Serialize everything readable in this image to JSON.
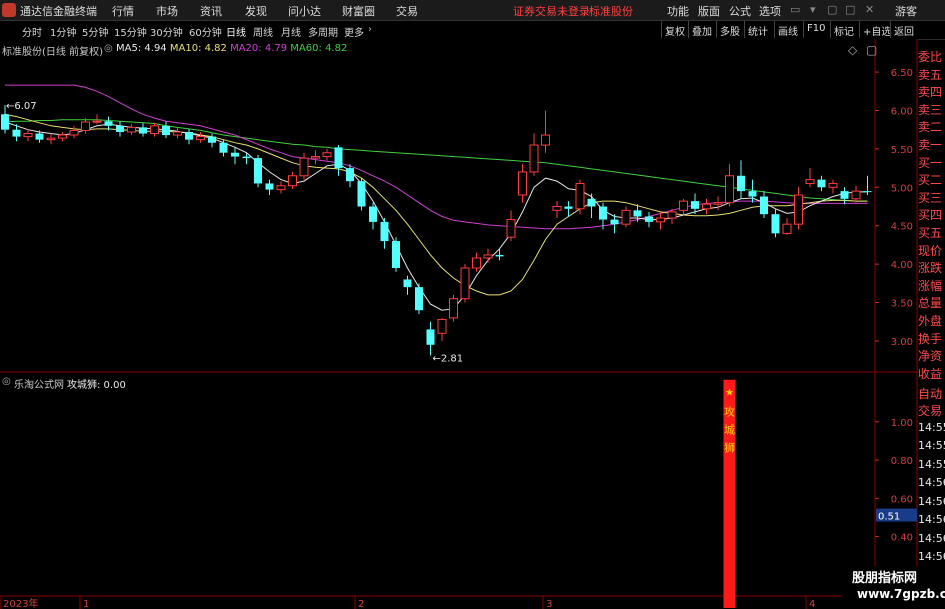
{
  "app": {
    "title": "通达信金融终端"
  },
  "menu": [
    "行情",
    "市场",
    "资讯",
    "发现",
    "问小达",
    "财富圈",
    "交易"
  ],
  "status": {
    "trade_notice": "证券交易未登录",
    "stock_name": "标准股份"
  },
  "right_menu": [
    "功能",
    "版面",
    "公式",
    "选项",
    "游客"
  ],
  "period_tabs": [
    "分时",
    "1分钟",
    "5分钟",
    "15分钟",
    "30分钟",
    "60分钟",
    "日线",
    "周线",
    "月线",
    "多周期",
    "更多"
  ],
  "active_tab": "日线",
  "right_buttons": [
    "复权",
    "叠加",
    "多股",
    "统计",
    "画线",
    "F10",
    "标记",
    "+自选",
    "返回"
  ],
  "main_chart": {
    "stock_label": "标准股份(日线 前复权)",
    "ma": [
      {
        "name": "MA5",
        "value": "4.94",
        "color": "#e8e8e8"
      },
      {
        "name": "MA10",
        "value": "4.82",
        "color": "#e8e070"
      },
      {
        "name": "MA20",
        "value": "4.79",
        "color": "#d040d0"
      },
      {
        "name": "MA60",
        "value": "4.82",
        "color": "#40d040"
      }
    ],
    "high_marker": "6.07",
    "low_marker": "2.81"
  },
  "sub_chart": {
    "label": "乐淘公式网",
    "indicator": "攻城狮: 0.00",
    "signal_text": [
      "攻",
      "城",
      "狮"
    ],
    "current_value": "0.51"
  },
  "side_panel": [
    "委比",
    "卖五",
    "卖四",
    "卖三",
    "卖二",
    "卖一",
    "买一",
    "买二",
    "买三",
    "买四",
    "买五",
    "现价",
    "涨跌",
    "涨幅",
    "总量",
    "外盘",
    "换手",
    "净资",
    "收益",
    "自动",
    "交易",
    "14:55",
    "14:55",
    "14:55",
    "14:56",
    "14:56",
    "14:56",
    "14:56",
    "14:56",
    "14:56"
  ],
  "x_axis": [
    "2023年",
    "1",
    "2",
    "3",
    "4"
  ],
  "watermark": {
    "line1": "股朋指标网",
    "line2": "www.7gpzb.com"
  },
  "chart_data": [
    {
      "type": "candlestick",
      "y_axis": {
        "min": 2.7,
        "max": 6.8,
        "ticks": [
          6.5,
          6.0,
          5.5,
          5.0,
          4.5,
          4.0,
          3.5,
          3.0
        ],
        "tick_labels": [
          "6.50",
          "6.00",
          "5.50",
          "5.00",
          "4.50",
          "4.00",
          "3.50",
          "3.00"
        ]
      },
      "candles": [
        [
          5.95,
          5.75,
          6.07,
          5.7
        ],
        [
          5.75,
          5.66,
          5.82,
          5.6
        ],
        [
          5.66,
          5.7,
          5.75,
          5.6
        ],
        [
          5.7,
          5.62,
          5.74,
          5.58
        ],
        [
          5.62,
          5.64,
          5.7,
          5.56
        ],
        [
          5.64,
          5.68,
          5.72,
          5.6
        ],
        [
          5.68,
          5.74,
          5.8,
          5.64
        ],
        [
          5.74,
          5.85,
          5.9,
          5.7
        ],
        [
          5.85,
          5.86,
          5.95,
          5.82
        ],
        [
          5.86,
          5.8,
          5.92,
          5.74
        ],
        [
          5.8,
          5.72,
          5.86,
          5.66
        ],
        [
          5.72,
          5.78,
          5.82,
          5.68
        ],
        [
          5.78,
          5.7,
          5.84,
          5.66
        ],
        [
          5.7,
          5.8,
          5.84,
          5.66
        ],
        [
          5.8,
          5.68,
          5.86,
          5.64
        ],
        [
          5.68,
          5.72,
          5.78,
          5.64
        ],
        [
          5.72,
          5.62,
          5.76,
          5.56
        ],
        [
          5.62,
          5.66,
          5.72,
          5.58
        ],
        [
          5.66,
          5.58,
          5.7,
          5.52
        ],
        [
          5.58,
          5.45,
          5.62,
          5.4
        ],
        [
          5.45,
          5.4,
          5.52,
          5.3
        ],
        [
          5.4,
          5.38,
          5.44,
          5.3
        ],
        [
          5.38,
          5.05,
          5.42,
          5.0
        ],
        [
          5.05,
          4.97,
          5.1,
          4.9
        ],
        [
          4.97,
          5.02,
          5.08,
          4.92
        ],
        [
          5.02,
          5.15,
          5.2,
          4.98
        ],
        [
          5.15,
          5.38,
          5.45,
          5.1
        ],
        [
          5.38,
          5.4,
          5.48,
          5.3
        ],
        [
          5.4,
          5.45,
          5.5,
          5.35
        ],
        [
          5.52,
          5.25,
          5.55,
          5.15
        ],
        [
          5.25,
          5.08,
          5.3,
          5.0
        ],
        [
          5.08,
          4.75,
          5.12,
          4.7
        ],
        [
          4.75,
          4.55,
          4.8,
          4.45
        ],
        [
          4.55,
          4.3,
          4.6,
          4.2
        ],
        [
          4.3,
          3.95,
          4.35,
          3.9
        ],
        [
          3.8,
          3.7,
          3.85,
          3.6
        ],
        [
          3.7,
          3.4,
          3.75,
          3.35
        ],
        [
          3.15,
          2.95,
          3.25,
          2.81
        ],
        [
          3.1,
          3.28,
          3.3,
          3.0
        ],
        [
          3.3,
          3.55,
          3.6,
          3.25
        ],
        [
          3.55,
          3.95,
          4.0,
          3.5
        ],
        [
          3.95,
          4.08,
          4.15,
          3.9
        ],
        [
          4.08,
          4.12,
          4.2,
          4.02
        ],
        [
          4.12,
          4.1,
          4.2,
          4.05
        ],
        [
          4.35,
          4.58,
          4.7,
          4.3
        ],
        [
          4.9,
          5.2,
          5.3,
          4.8
        ],
        [
          5.2,
          5.55,
          5.7,
          5.15
        ],
        [
          5.55,
          5.68,
          6.0,
          5.45
        ],
        [
          4.7,
          4.75,
          4.82,
          4.6
        ],
        [
          4.75,
          4.72,
          4.82,
          4.62
        ],
        [
          4.72,
          5.05,
          5.1,
          4.65
        ],
        [
          4.85,
          4.75,
          4.92,
          4.6
        ],
        [
          4.75,
          4.58,
          4.8,
          4.45
        ],
        [
          4.58,
          4.52,
          4.65,
          4.4
        ],
        [
          4.52,
          4.7,
          4.75,
          4.48
        ],
        [
          4.7,
          4.62,
          4.78,
          4.55
        ],
        [
          4.62,
          4.55,
          4.68,
          4.48
        ],
        [
          4.55,
          4.6,
          4.68,
          4.45
        ],
        [
          4.6,
          4.68,
          4.72,
          4.52
        ],
        [
          4.7,
          4.82,
          4.85,
          4.65
        ],
        [
          4.82,
          4.72,
          4.92,
          4.65
        ],
        [
          4.72,
          4.78,
          4.85,
          4.65
        ],
        [
          4.78,
          4.8,
          4.88,
          4.7
        ],
        [
          4.8,
          5.15,
          5.3,
          4.75
        ],
        [
          5.15,
          4.95,
          5.35,
          4.85
        ],
        [
          4.95,
          4.88,
          5.1,
          4.8
        ],
        [
          4.88,
          4.65,
          4.95,
          4.6
        ],
        [
          4.65,
          4.4,
          4.72,
          4.35
        ],
        [
          4.4,
          4.52,
          4.6,
          4.38
        ],
        [
          4.52,
          4.9,
          5.0,
          4.45
        ],
        [
          5.05,
          5.1,
          5.25,
          5.0
        ],
        [
          5.1,
          5.0,
          5.15,
          4.95
        ],
        [
          5.0,
          5.05,
          5.1,
          4.92
        ],
        [
          4.95,
          4.85,
          5.0,
          4.78
        ],
        [
          4.85,
          4.95,
          5.02,
          4.8
        ],
        [
          4.95,
          4.94,
          5.15,
          4.9
        ]
      ],
      "ma60": [
        5.85,
        5.86,
        5.86,
        5.87,
        5.87,
        5.88,
        5.88,
        5.88,
        5.88,
        5.87,
        5.86,
        5.85,
        5.84,
        5.83,
        5.8,
        5.78,
        5.76,
        5.74,
        5.71,
        5.68,
        5.66,
        5.64,
        5.62,
        5.6,
        5.58,
        5.56,
        5.55,
        5.53,
        5.52,
        5.5,
        5.49,
        5.48,
        5.47,
        5.46,
        5.45,
        5.44,
        5.43,
        5.42,
        5.41,
        5.4,
        5.39,
        5.38,
        5.37,
        5.36,
        5.35,
        5.34,
        5.33,
        5.32,
        5.3,
        5.28,
        5.26,
        5.24,
        5.22,
        5.2,
        5.18,
        5.16,
        5.14,
        5.12,
        5.1,
        5.08,
        5.06,
        5.04,
        5.02,
        5.0,
        4.98,
        4.96,
        4.94,
        4.92,
        4.9,
        4.88,
        4.86,
        4.85,
        4.84,
        4.83,
        4.82,
        4.82
      ],
      "ma20": [
        6.33,
        6.33,
        6.33,
        6.33,
        6.33,
        6.33,
        6.33,
        6.3,
        6.25,
        6.18,
        6.1,
        6.02,
        5.95,
        5.9,
        5.86,
        5.84,
        5.82,
        5.8,
        5.76,
        5.72,
        5.68,
        5.62,
        5.56,
        5.5,
        5.45,
        5.4,
        5.38,
        5.36,
        5.34,
        5.32,
        5.28,
        5.22,
        5.15,
        5.08,
        5.0,
        4.9,
        4.8,
        4.7,
        4.62,
        4.57,
        4.55,
        4.53,
        4.51,
        4.5,
        4.49,
        4.48,
        4.47,
        4.46,
        4.46,
        4.46,
        4.47,
        4.48,
        4.5,
        4.52,
        4.55,
        4.58,
        4.62,
        4.66,
        4.7,
        4.74,
        4.77,
        4.79,
        4.8,
        4.81,
        4.82,
        4.82,
        4.82,
        4.81,
        4.8,
        4.79,
        4.79,
        4.79,
        4.79,
        4.79,
        4.79,
        4.79
      ],
      "ma10": [
        5.95,
        5.92,
        5.88,
        5.84,
        5.8,
        5.78,
        5.76,
        5.75,
        5.76,
        5.76,
        5.75,
        5.74,
        5.73,
        5.73,
        5.73,
        5.72,
        5.71,
        5.68,
        5.66,
        5.62,
        5.58,
        5.55,
        5.5,
        5.44,
        5.38,
        5.32,
        5.28,
        5.26,
        5.25,
        5.24,
        5.2,
        5.12,
        5.0,
        4.85,
        4.7,
        4.52,
        4.32,
        4.12,
        3.95,
        3.82,
        3.72,
        3.65,
        3.6,
        3.6,
        3.65,
        3.8,
        4.05,
        4.32,
        4.52,
        4.62,
        4.72,
        4.8,
        4.82,
        4.82,
        4.8,
        4.76,
        4.72,
        4.68,
        4.66,
        4.64,
        4.63,
        4.63,
        4.64,
        4.66,
        4.7,
        4.74,
        4.76,
        4.76,
        4.76,
        4.78,
        4.8,
        4.82,
        4.83,
        4.83,
        4.82,
        4.82
      ],
      "ma5": [
        5.85,
        5.8,
        5.75,
        5.72,
        5.7,
        5.68,
        5.7,
        5.75,
        5.8,
        5.82,
        5.8,
        5.78,
        5.77,
        5.76,
        5.75,
        5.73,
        5.7,
        5.67,
        5.64,
        5.58,
        5.52,
        5.45,
        5.32,
        5.2,
        5.1,
        5.05,
        5.08,
        5.18,
        5.28,
        5.3,
        5.22,
        5.05,
        4.82,
        4.55,
        4.25,
        3.95,
        3.7,
        3.48,
        3.4,
        3.42,
        3.6,
        3.85,
        4.05,
        4.2,
        4.4,
        4.68,
        5.0,
        5.12,
        5.08,
        4.98,
        4.96,
        4.88,
        4.7,
        4.62,
        4.6,
        4.6,
        4.58,
        4.58,
        4.6,
        4.64,
        4.68,
        4.72,
        4.74,
        4.8,
        4.85,
        4.86,
        4.8,
        4.72,
        4.66,
        4.68,
        4.76,
        4.82,
        4.88,
        4.92,
        4.94,
        4.94
      ]
    },
    {
      "type": "bar",
      "indicator": "攻城狮",
      "y_axis": {
        "min": 0.1,
        "max": 1.25,
        "ticks": [
          1.0,
          0.8,
          0.6,
          0.4,
          0.2
        ],
        "tick_labels": [
          "1.00",
          "0.80",
          "0.60",
          "0.40",
          "0.20"
        ]
      },
      "signal": {
        "candle_index": 63,
        "value": 1.0
      },
      "current_value": 0.51
    }
  ]
}
